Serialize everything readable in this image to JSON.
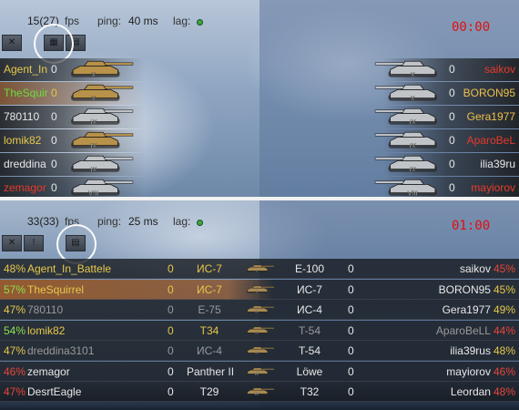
{
  "colors": {
    "ally_yellow": "#e6c84a",
    "ally_green": "#6fdc3c",
    "ally_white": "#e8e8e8",
    "enemy_red": "#e83a2a",
    "enemy_gold": "#eec04a",
    "grey": "#9a9a9a",
    "timer_red": "#e01010",
    "pct_good": "#8fe04a",
    "pct_ok": "#e6c84a",
    "pct_bad": "#e8453a"
  },
  "top": {
    "fps": "15(27)",
    "fps_label": "fps",
    "ping_label": "ping:",
    "ping": "40 ms",
    "lag_label": "lag:",
    "timer": "00:00",
    "toolbar": [
      "✕",
      "▦",
      "▤"
    ],
    "allies": [
      {
        "name": "Agent_In",
        "frags": "0",
        "color": "#e6c84a",
        "tier": "X",
        "tank_color": "#b8924a",
        "highlight": false
      },
      {
        "name": "TheSquir",
        "frags": "0",
        "color": "#6fdc3c",
        "tier": "X",
        "tank_color": "#b8924a",
        "highlight": true
      },
      {
        "name": "780110",
        "frags": "0",
        "color": "#e8e8e8",
        "tier": "IX",
        "tank_color": "#c0c4c8",
        "highlight": false
      },
      {
        "name": "lomik82",
        "frags": "0",
        "color": "#e6c84a",
        "tier": "IX",
        "tank_color": "#b8924a",
        "highlight": false
      },
      {
        "name": "dreddina",
        "frags": "0",
        "color": "#e8e8e8",
        "tier": "IX",
        "tank_color": "#c0c4c8",
        "highlight": false
      },
      {
        "name": "zemagor",
        "frags": "0",
        "color": "#e83a2a",
        "tier": "VIII",
        "tank_color": "#c0c4c8",
        "highlight": false
      }
    ],
    "enemies": [
      {
        "name": "saikov",
        "frags": "0",
        "color": "#e83a2a",
        "tier": "X"
      },
      {
        "name": "BORON95",
        "frags": "0",
        "color": "#eec04a",
        "tier": "X"
      },
      {
        "name": "Gera1977",
        "frags": "0",
        "color": "#eec04a",
        "tier": "IX"
      },
      {
        "name": "AparoBeL",
        "frags": "0",
        "color": "#e83a2a",
        "tier": "IX"
      },
      {
        "name": "ilia39ru",
        "frags": "0",
        "color": "#e8e8e8",
        "tier": "IX"
      },
      {
        "name": "mayiorov",
        "frags": "0",
        "color": "#e83a2a",
        "tier": "VIII"
      }
    ]
  },
  "bottom": {
    "fps": "33(33)",
    "fps_label": "fps",
    "ping_label": "ping:",
    "ping": "25 ms",
    "lag_label": "lag:",
    "timer": "01:00",
    "toolbar": [
      "✕",
      "!",
      "▤"
    ],
    "rows": [
      {
        "pct_l": "48%",
        "pct_l_color": "#e6c84a",
        "name_l": "Agent_In_Battele",
        "name_l_color": "#e6c84a",
        "frags_l": "0",
        "frags_l_color": "#e6c84a",
        "tank_l": "ИС-7",
        "tank_l_color": "#e6c84a",
        "tank_r": "E-100",
        "tank_r_color": "#e8e8e8",
        "frags_r": "0",
        "name_r": "saikov",
        "name_r_color": "#e8e8e8",
        "pct_r": "45%",
        "pct_r_color": "#e8453a",
        "highlight": false,
        "tier_l": "X",
        "tier_r": "X"
      },
      {
        "pct_l": "57%",
        "pct_l_color": "#8fe04a",
        "name_l": "TheSquirrel",
        "name_l_color": "#e6c84a",
        "frags_l": "0",
        "frags_l_color": "#e6c84a",
        "tank_l": "ИС-7",
        "tank_l_color": "#e6c84a",
        "tank_r": "ИС-7",
        "tank_r_color": "#e8e8e8",
        "frags_r": "0",
        "name_r": "BORON95",
        "name_r_color": "#e8e8e8",
        "pct_r": "45%",
        "pct_r_color": "#e6c84a",
        "highlight": true,
        "tier_l": "X",
        "tier_r": "X"
      },
      {
        "pct_l": "47%",
        "pct_l_color": "#e6c84a",
        "name_l": "780110",
        "name_l_color": "#9a9a9a",
        "frags_l": "0",
        "frags_l_color": "#9a9a9a",
        "tank_l": "E-75",
        "tank_l_color": "#9a9a9a",
        "tank_r": "ИС-4",
        "tank_r_color": "#e8e8e8",
        "frags_r": "0",
        "name_r": "Gera1977",
        "name_r_color": "#e8e8e8",
        "pct_r": "49%",
        "pct_r_color": "#e6c84a",
        "highlight": false,
        "tier_l": "IX",
        "tier_r": "IX"
      },
      {
        "pct_l": "54%",
        "pct_l_color": "#8fe04a",
        "name_l": "lomik82",
        "name_l_color": "#e6c84a",
        "frags_l": "0",
        "frags_l_color": "#e6c84a",
        "tank_l": "T34",
        "tank_l_color": "#e6c84a",
        "tank_r": "T-54",
        "tank_r_color": "#9a9a9a",
        "frags_r": "0",
        "name_r": "AparoBeLL",
        "name_r_color": "#9a9a9a",
        "pct_r": "44%",
        "pct_r_color": "#e8453a",
        "highlight": false,
        "tier_l": "IX",
        "tier_r": "IX"
      },
      {
        "pct_l": "47%",
        "pct_l_color": "#e6c84a",
        "name_l": "dreddina3101",
        "name_l_color": "#9a9a9a",
        "frags_l": "0",
        "frags_l_color": "#9a9a9a",
        "tank_l": "ИС-4",
        "tank_l_color": "#9a9a9a",
        "tank_r": "T-54",
        "tank_r_color": "#e8e8e8",
        "frags_r": "0",
        "name_r": "ilia39rus",
        "name_r_color": "#e8e8e8",
        "pct_r": "48%",
        "pct_r_color": "#e6c84a",
        "highlight": false,
        "tier_l": "IX",
        "tier_r": "IX"
      },
      {
        "pct_l": "46%",
        "pct_l_color": "#e8453a",
        "name_l": "zemagor",
        "name_l_color": "#e8e8e8",
        "frags_l": "0",
        "frags_l_color": "#e8e8e8",
        "tank_l": "Panther II",
        "tank_l_color": "#e8e8e8",
        "tank_r": "Löwe",
        "tank_r_color": "#e8e8e8",
        "frags_r": "0",
        "name_r": "mayiorov",
        "name_r_color": "#e8e8e8",
        "pct_r": "46%",
        "pct_r_color": "#e8453a",
        "highlight": false,
        "tier_l": "VIII",
        "tier_r": "VIII"
      },
      {
        "pct_l": "47%",
        "pct_l_color": "#e8453a",
        "name_l": "DesrtEagle",
        "name_l_color": "#e8e8e8",
        "frags_l": "0",
        "frags_l_color": "#e8e8e8",
        "tank_l": "T29",
        "tank_l_color": "#e8e8e8",
        "tank_r": "T32",
        "tank_r_color": "#e8e8e8",
        "frags_r": "0",
        "name_r": "Leordan",
        "name_r_color": "#e8e8e8",
        "pct_r": "48%",
        "pct_r_color": "#e8453a",
        "highlight": false,
        "tier_l": "VIII",
        "tier_r": "VIII"
      }
    ]
  }
}
